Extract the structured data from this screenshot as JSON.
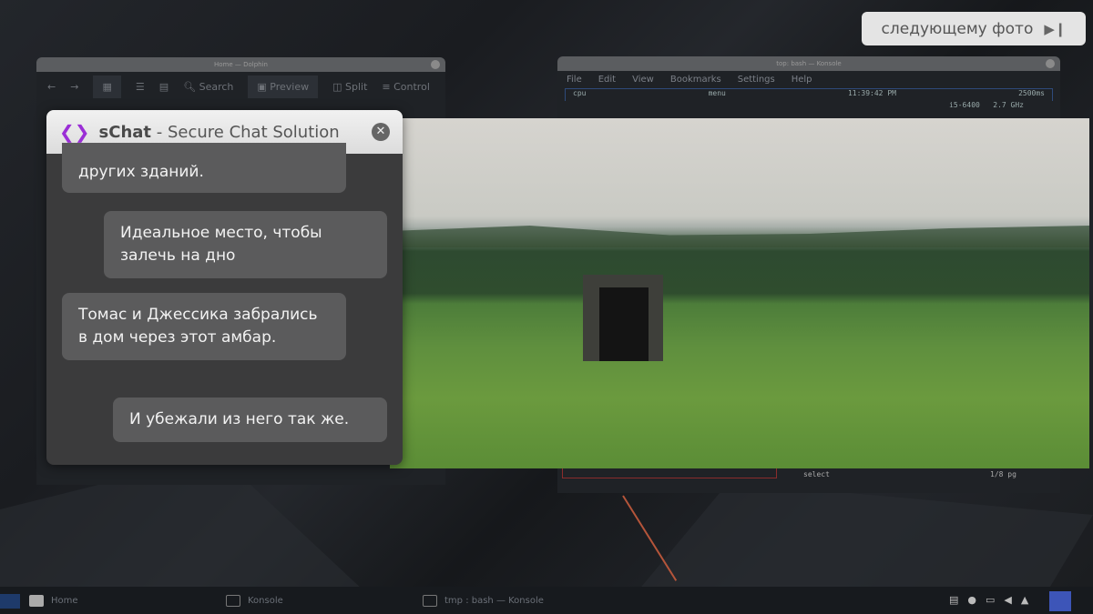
{
  "next_photo_button": {
    "label": "следующему фото",
    "icon": "skip-next-icon"
  },
  "dolphin_window": {
    "title": "Home — Dolphin",
    "toolbar": [
      "Search",
      "Preview",
      "Split",
      "Control"
    ]
  },
  "konsole_window": {
    "title": "top: bash — Konsole",
    "menu": [
      "File",
      "Edit",
      "View",
      "Bookmarks",
      "Settings",
      "Help"
    ],
    "cpu_label": "cpu",
    "menu_label": "menu",
    "clock": "11:39:42 PM",
    "interval": "2500ms",
    "cpu_model": "i5-6400",
    "freq": "2.7 GHz",
    "select_label": "select",
    "page_label": "1/8 pg"
  },
  "chat": {
    "app_name": "sChat",
    "subtitle": "- Secure Chat Solution",
    "messages": [
      {
        "side": "left",
        "text": "других зданий."
      },
      {
        "side": "right",
        "text": "Идеальное место, чтобы залечь на дно"
      },
      {
        "side": "left",
        "text": "Томас и Джессика забрались в дом через этот амбар."
      },
      {
        "side": "right",
        "text": "И убежали из него так же."
      }
    ]
  },
  "taskbar": {
    "items": [
      "Home",
      "Konsole",
      "tmp : bash — Konsole"
    ]
  }
}
